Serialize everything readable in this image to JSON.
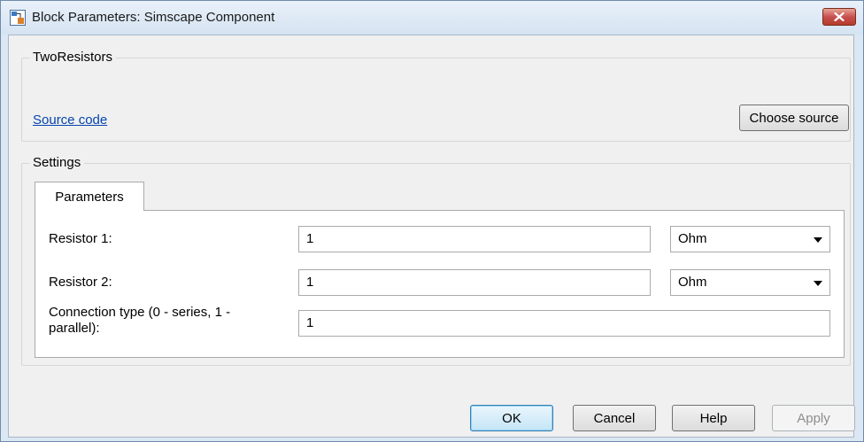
{
  "window": {
    "title": "Block Parameters: Simscape Component"
  },
  "icons": {
    "app": "simulink-block-icon",
    "close": "close-icon",
    "dropdown": "chevron-down-icon"
  },
  "colors": {
    "link": "#0645ad",
    "close_button": "#c75050",
    "window_frame": "#dbe7f3"
  },
  "component_group": {
    "title": "TwoResistors",
    "link_label": "Source code",
    "choose_button_label": "Choose source"
  },
  "settings_group": {
    "title": "Settings",
    "tabs": [
      {
        "label": "Parameters",
        "selected": true
      }
    ],
    "params": [
      {
        "label": "Resistor 1:",
        "value": "1",
        "unit": "Ohm"
      },
      {
        "label": "Resistor 2:",
        "value": "1",
        "unit": "Ohm"
      },
      {
        "label": "Connection type (0 - series, 1 - parallel):",
        "value": "1"
      }
    ]
  },
  "buttons": {
    "ok": "OK",
    "cancel": "Cancel",
    "help": "Help",
    "apply": "Apply"
  }
}
